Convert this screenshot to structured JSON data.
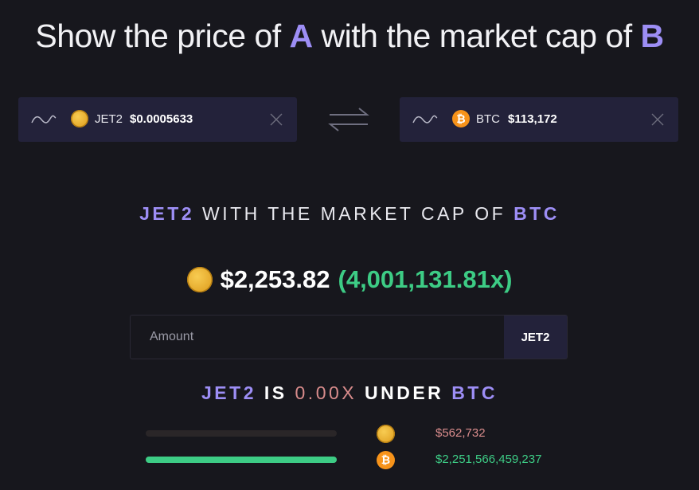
{
  "headline": {
    "prefix": "Show the price of ",
    "a": "A",
    "middle": " with the market cap of ",
    "b": "B"
  },
  "token_a": {
    "symbol": "JET2",
    "price": "$0.0005633",
    "icon": "jet2-coin-icon"
  },
  "token_b": {
    "symbol": "BTC",
    "price": "$113,172",
    "icon": "bitcoin-icon",
    "glyph": "₿"
  },
  "subtitle": {
    "token_a": "JET2",
    "middle": " WITH THE MARKET CAP OF ",
    "token_b": "BTC"
  },
  "result": {
    "price": "$2,253.82",
    "multiplier": "(4,001,131.81x)"
  },
  "amount": {
    "placeholder": "Amount",
    "unit": "JET2"
  },
  "verdict": {
    "token_a": "JET2",
    "is": " IS ",
    "ratio": "0.00X",
    "under": " UNDER ",
    "token_b": "BTC"
  },
  "comparison": [
    {
      "coin": "jet2-coin-icon",
      "market_cap": "$562,732",
      "fill": 0.0,
      "tone": "red"
    },
    {
      "coin": "bitcoin-icon",
      "market_cap": "$2,251,566,459,237",
      "fill": 1.0,
      "tone": "green"
    }
  ],
  "colors": {
    "background": "#17171d",
    "panel": "#23223a",
    "accent": "#9d8ef5",
    "positive": "#3dcc85",
    "negative": "#d98c8c",
    "btc": "#f7931a"
  }
}
